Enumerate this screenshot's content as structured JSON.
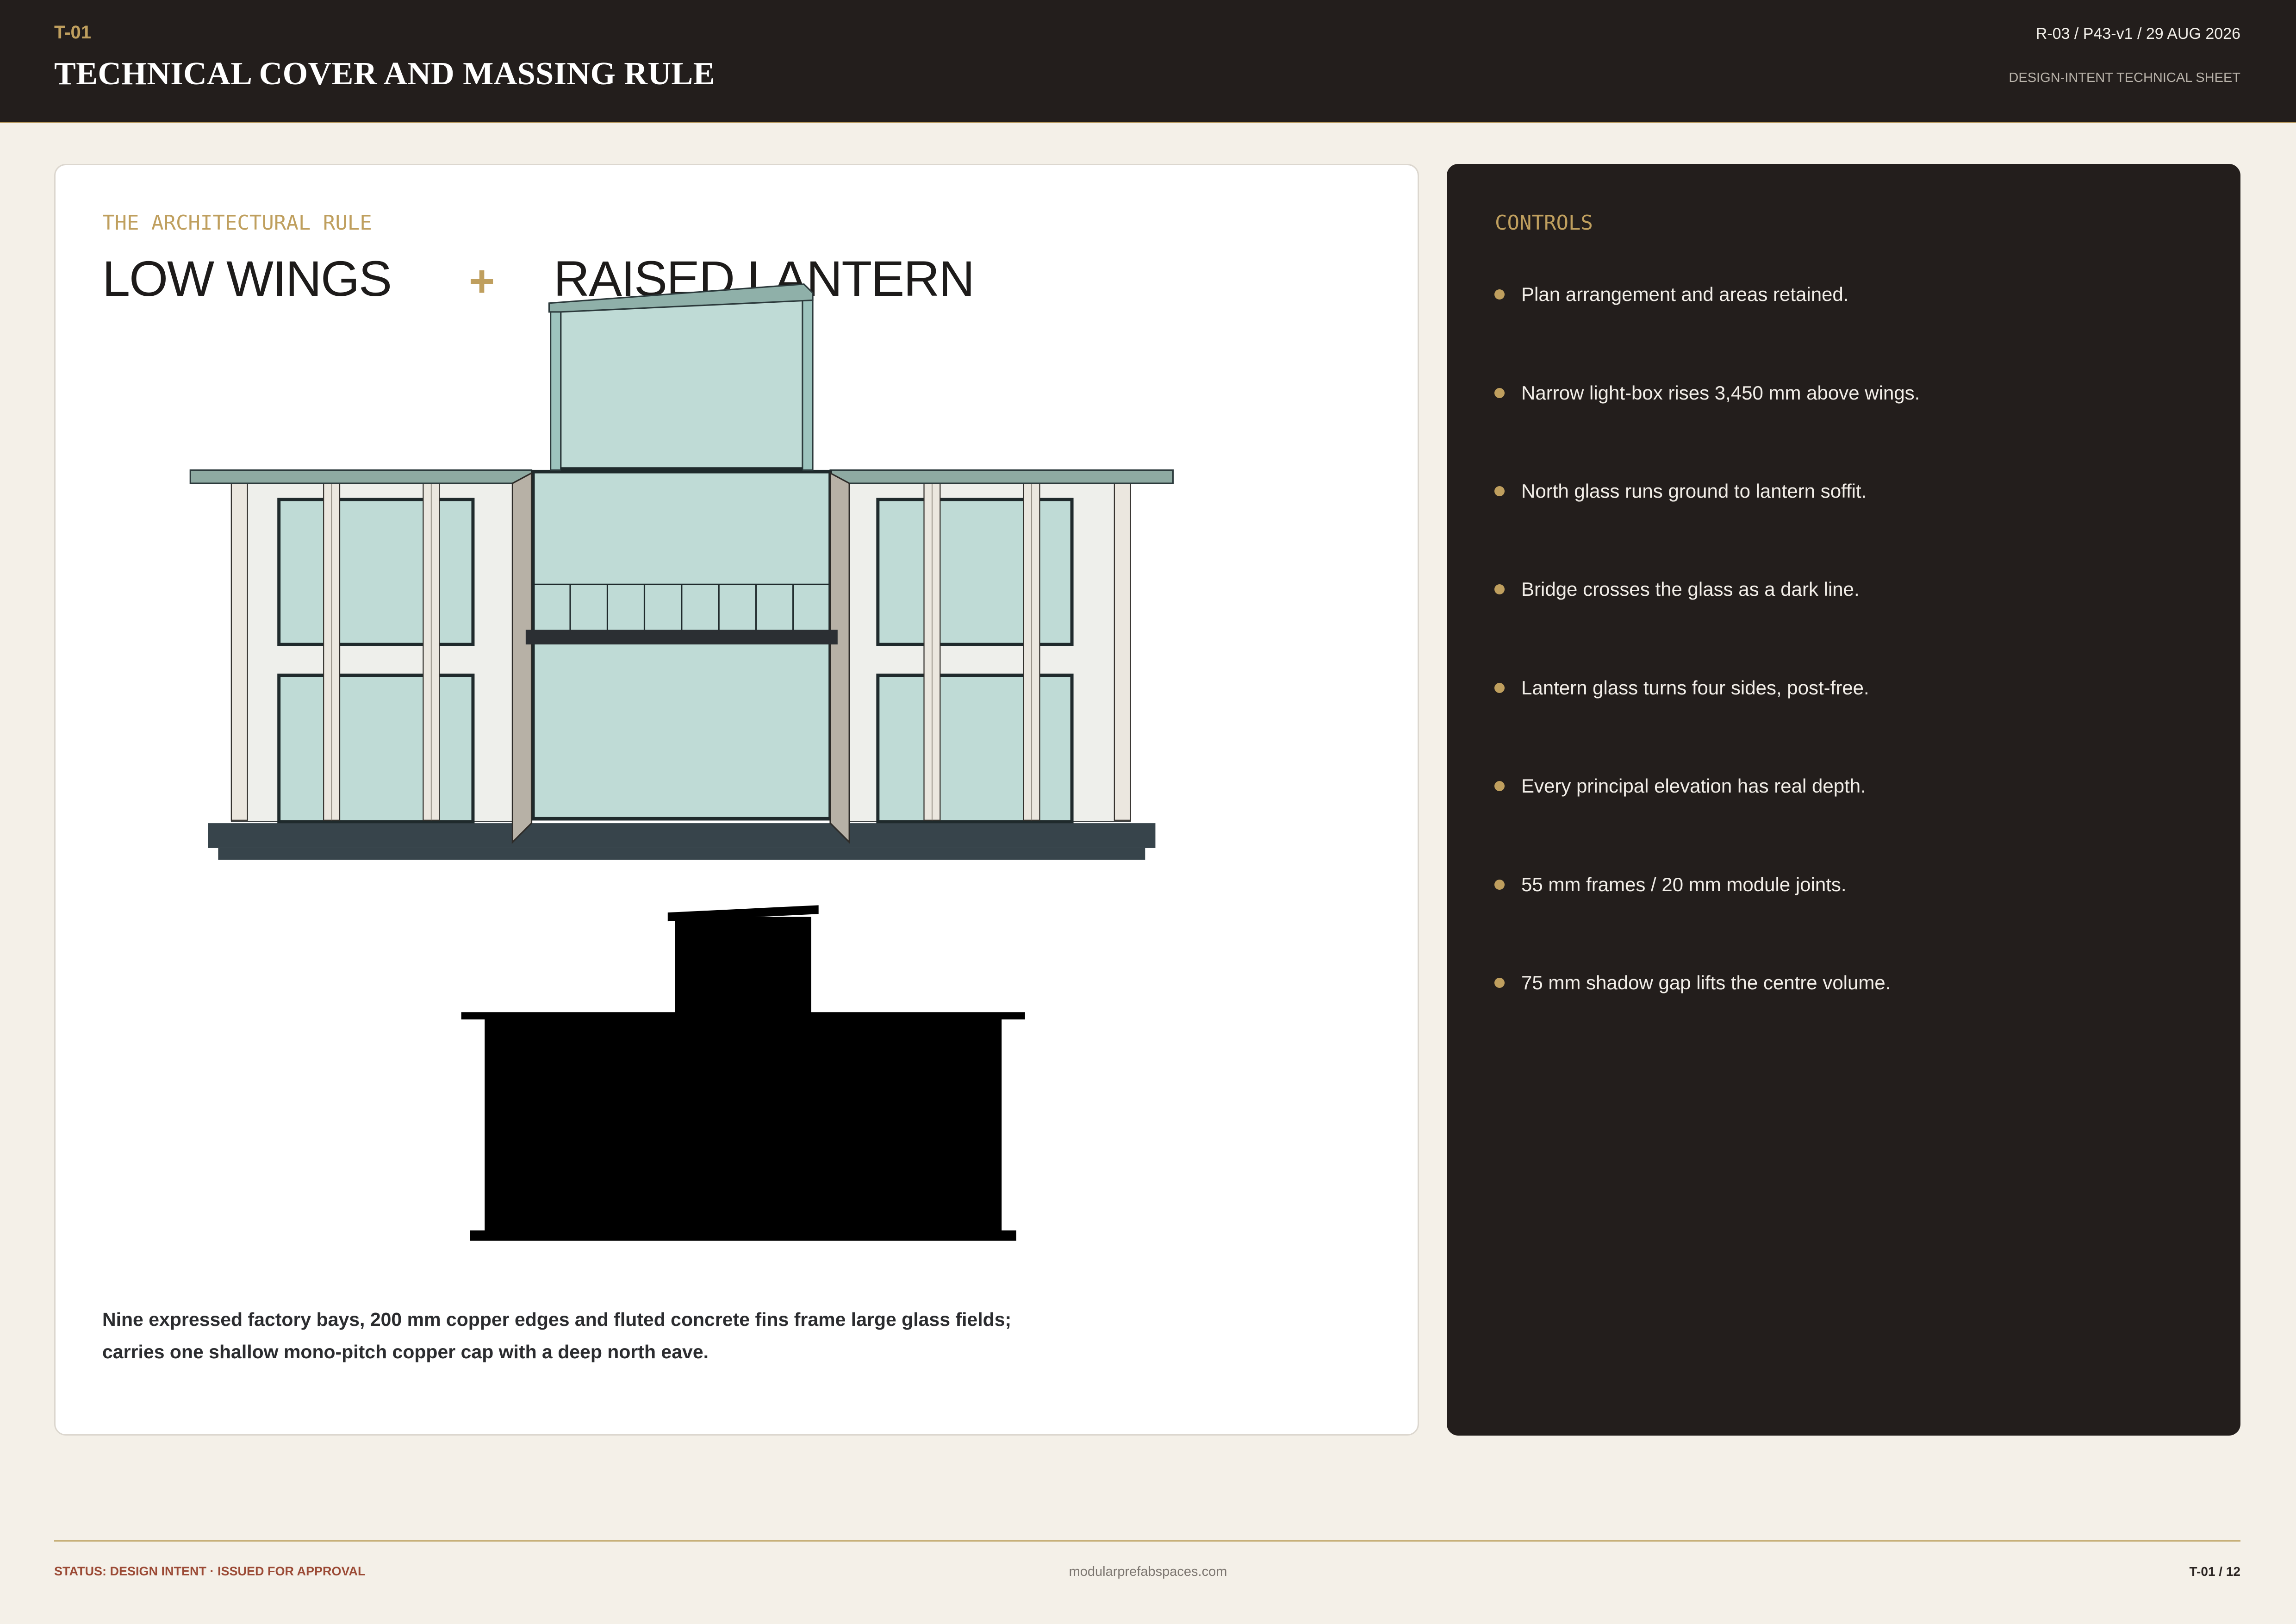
{
  "header": {
    "sheet_code": "T-01",
    "title": "TECHNICAL COVER AND MASSING RULE",
    "revision": "R-03 / P43-v1 / 29 AUG 2026",
    "sheet_type": "DESIGN-INTENT TECHNICAL SHEET"
  },
  "rule_card": {
    "kicker": "THE ARCHITECTURAL RULE",
    "headline": {
      "left": "LOW WINGS",
      "join": "+",
      "right": "RAISED LANTERN"
    },
    "caption": [
      "Nine expressed factory bays, 200 mm copper edges and fluted concrete fins frame large glass fields;",
      "carries one shallow mono-pitch copper cap with a deep north eave."
    ]
  },
  "controls": {
    "heading": "CONTROLS",
    "items": [
      "Plan arrangement and areas retained.",
      "Narrow light-box rises 3,450 mm above wings.",
      "North glass runs ground to lantern soffit.",
      "Bridge crosses the glass as a dark line.",
      "Lantern glass turns four sides, post-free.",
      "Every principal elevation has real depth.",
      "55 mm frames / 20 mm module joints.",
      "75 mm shadow gap lifts the centre volume."
    ]
  },
  "footer": {
    "status": "STATUS: DESIGN INTENT · ISSUED FOR APPROVAL",
    "website": "modularprefabspaces.com",
    "page": "T-01 / 12"
  },
  "colors": {
    "page_bg": "#f4f0e8",
    "header_bg": "#231e1c",
    "panel_bg": "#231e1c",
    "accent_gold": "#bf9f5e",
    "status_red": "#9b4a35",
    "glass": "#bfdbd6",
    "plinth": "#37444b"
  }
}
